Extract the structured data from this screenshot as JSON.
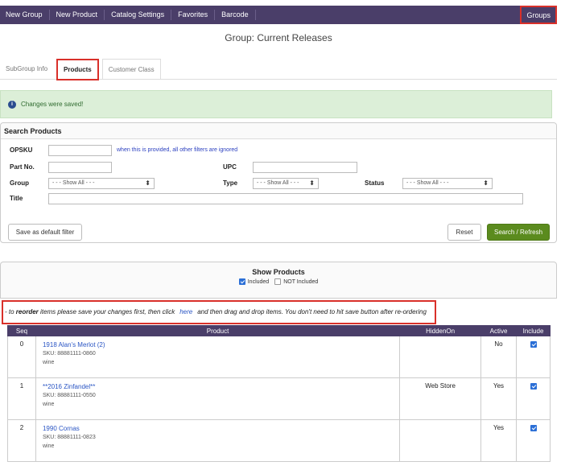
{
  "nav": {
    "items": [
      "New Group",
      "New Product",
      "Catalog Settings",
      "Favorites",
      "Barcode"
    ],
    "right": "Groups",
    "bg": "#4a3e69"
  },
  "heading": "Group: Current Releases",
  "tabs": [
    "SubGroup Info",
    "Products",
    "Customer Class"
  ],
  "alert": {
    "text": "Changes were saved!",
    "icon": "info-icon"
  },
  "search": {
    "title": "Search Products",
    "opsku_label": "OPSKU",
    "opsku_hint": "when this is provided, all other filters are ignored",
    "partno_label": "Part No.",
    "upc_label": "UPC",
    "group_label": "Group",
    "group_value": "- - - Show All - - -",
    "type_label": "Type",
    "type_value": "- - - Show All - - -",
    "status_label": "Status",
    "status_value": "- - - Show All - - -",
    "title_label": "Title",
    "save_default": "Save as default filter",
    "reset": "Reset",
    "search_refresh": "Search / Refresh"
  },
  "show": {
    "title": "Show Products",
    "included": "Included",
    "not_included": "NOT Included"
  },
  "reorder": {
    "prefix": "- to ",
    "bold": "reorder",
    "middle": " items please save your changes first, then click",
    "link": "here",
    "suffix": "and then drag and drop items. You don't need to hit save button after re-ordering"
  },
  "table": {
    "headers": [
      "Seq",
      "Product",
      "HiddenOn",
      "Active",
      "Include"
    ],
    "rows": [
      {
        "seq": "0",
        "name": "1918 Alan's Merlot (2)",
        "sku": "SKU: 88881111-0860",
        "category": "wine",
        "hidden_on": "",
        "active": "No",
        "include": true
      },
      {
        "seq": "1",
        "name": "**2016 Zinfandel**",
        "sku": "SKU: 88881111-0550",
        "category": "wine",
        "hidden_on": "Web Store",
        "active": "Yes",
        "include": true
      },
      {
        "seq": "2",
        "name": "1990 Cornas",
        "sku": "SKU: 88881111-0823",
        "category": "wine",
        "hidden_on": "",
        "active": "Yes",
        "include": true
      }
    ]
  }
}
